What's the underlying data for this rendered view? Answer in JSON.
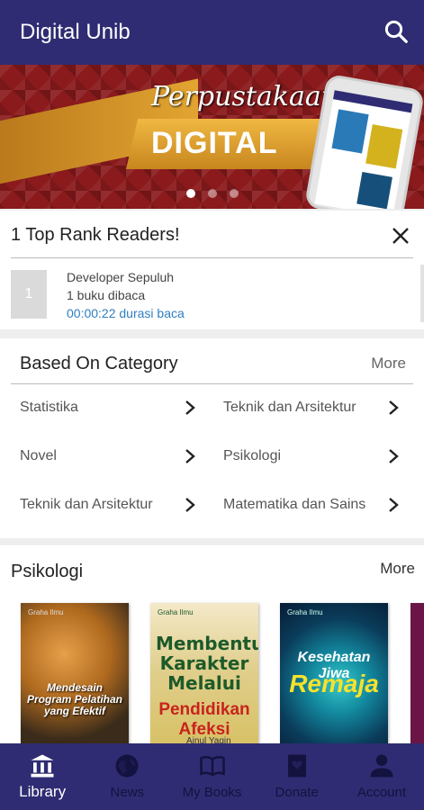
{
  "app_bar": {
    "title": "Digital Unib",
    "search_icon": "search-icon"
  },
  "banner": {
    "script_text": "Perpustakaan",
    "headline": "DIGITAL",
    "slide_count": 3,
    "active_slide": 1
  },
  "top_readers": {
    "title": "1 Top Rank Readers!",
    "entries": [
      {
        "rank": "1",
        "name": "Developer Sepuluh",
        "books_read": "1 buku dibaca",
        "duration": "00:00:22 durasi baca"
      }
    ]
  },
  "categories": {
    "title": "Based On Category",
    "more_label": "More",
    "items": [
      {
        "label": "Statistika"
      },
      {
        "label": "Teknik dan Arsitektur"
      },
      {
        "label": "Novel"
      },
      {
        "label": "Psikologi"
      },
      {
        "label": "Teknik dan Arsitektur"
      },
      {
        "label": "Matematika dan Sains"
      }
    ]
  },
  "books_section": {
    "title": "Psikologi",
    "more_label": "More",
    "books": [
      {
        "title": "Mendesain Program Pelatihan yang Efektif",
        "publisher": "Graha Ilmu"
      },
      {
        "title_line1": "Membentuk Karakter Melalui",
        "title_line2": "Pendidikan Afeksi",
        "publisher": "Graha Ilmu",
        "author": "Ainul Yaqin"
      },
      {
        "title_line1": "Kesehatan Jiwa",
        "title_line2": "Remaja",
        "publisher": "Graha Ilmu"
      }
    ]
  },
  "bottom_nav": {
    "tabs": [
      {
        "label": "Library",
        "icon": "library-icon",
        "active": true
      },
      {
        "label": "News",
        "icon": "globe-icon",
        "active": false
      },
      {
        "label": "My Books",
        "icon": "book-open-icon",
        "active": false
      },
      {
        "label": "Donate",
        "icon": "donate-book-icon",
        "active": false
      },
      {
        "label": "Account",
        "icon": "person-icon",
        "active": false
      }
    ]
  },
  "colors": {
    "primary": "#2f2c73",
    "link": "#2f7fc1",
    "inactive_tab": "#14123f"
  }
}
